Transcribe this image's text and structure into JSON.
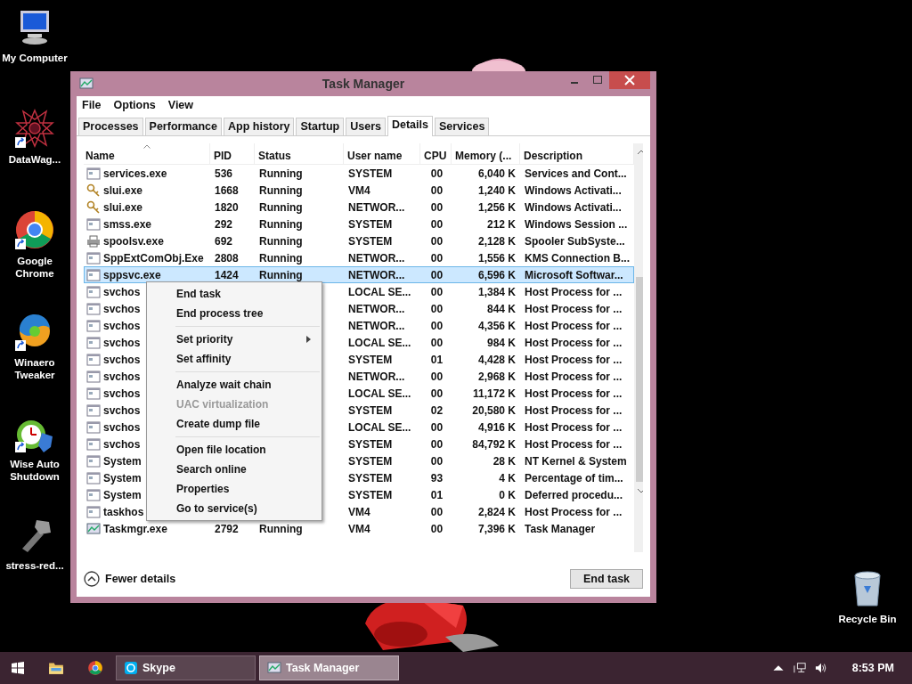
{
  "desktop_icons": [
    {
      "label": "My Computer",
      "kind": "computer",
      "shortcut": false
    },
    {
      "label": "DataWag...",
      "kind": "star",
      "shortcut": true
    },
    {
      "label": "Google Chrome",
      "kind": "chrome",
      "shortcut": true
    },
    {
      "label": "Winaero Tweaker",
      "kind": "swirl",
      "shortcut": true
    },
    {
      "label": "Wise Auto Shutdown",
      "kind": "clock",
      "shortcut": true
    },
    {
      "label": "stress-red...",
      "kind": "tool",
      "shortcut": false
    }
  ],
  "recycle_bin": {
    "label": "Recycle Bin"
  },
  "window": {
    "title": "Task Manager",
    "menu": [
      "File",
      "Options",
      "View"
    ],
    "tabs": [
      {
        "label": "Processes",
        "selected": false
      },
      {
        "label": "Performance",
        "selected": false
      },
      {
        "label": "App history",
        "selected": false
      },
      {
        "label": "Startup",
        "selected": false
      },
      {
        "label": "Users",
        "selected": false
      },
      {
        "label": "Details",
        "selected": true
      },
      {
        "label": "Services",
        "selected": false
      }
    ],
    "columns": [
      {
        "label": "Name",
        "sorted": true
      },
      {
        "label": "PID",
        "sorted": false
      },
      {
        "label": "Status",
        "sorted": false
      },
      {
        "label": "User name",
        "sorted": false
      },
      {
        "label": "CPU",
        "sorted": false
      },
      {
        "label": "Memory (...",
        "sorted": false
      },
      {
        "label": "Description",
        "sorted": false
      }
    ],
    "rows": [
      {
        "kind": "app",
        "name": "services.exe",
        "pid": "536",
        "status": "Running",
        "user": "SYSTEM",
        "cpu": "00",
        "memory": "6,040 K",
        "description": "Services and Cont...",
        "selected": false
      },
      {
        "kind": "key",
        "name": "slui.exe",
        "pid": "1668",
        "status": "Running",
        "user": "VM4",
        "cpu": "00",
        "memory": "1,240 K",
        "description": "Windows Activati...",
        "selected": false
      },
      {
        "kind": "key",
        "name": "slui.exe",
        "pid": "1820",
        "status": "Running",
        "user": "NETWOR...",
        "cpu": "00",
        "memory": "1,256 K",
        "description": "Windows Activati...",
        "selected": false
      },
      {
        "kind": "app",
        "name": "smss.exe",
        "pid": "292",
        "status": "Running",
        "user": "SYSTEM",
        "cpu": "00",
        "memory": "212 K",
        "description": "Windows Session ...",
        "selected": false
      },
      {
        "kind": "printer",
        "name": "spoolsv.exe",
        "pid": "692",
        "status": "Running",
        "user": "SYSTEM",
        "cpu": "00",
        "memory": "2,128 K",
        "description": "Spooler SubSyste...",
        "selected": false
      },
      {
        "kind": "app",
        "name": "SppExtComObj.Exe",
        "pid": "2808",
        "status": "Running",
        "user": "NETWOR...",
        "cpu": "00",
        "memory": "1,556 K",
        "description": "KMS Connection B...",
        "selected": false
      },
      {
        "kind": "app",
        "name": "sppsvc.exe",
        "pid": "1424",
        "status": "Running",
        "user": "NETWOR...",
        "cpu": "00",
        "memory": "6,596 K",
        "description": "Microsoft Softwar...",
        "selected": true
      },
      {
        "kind": "app",
        "name": "svchos",
        "user": "LOCAL SE...",
        "cpu": "00",
        "memory": "1,384 K",
        "description": "Host Process for ...",
        "selected": false
      },
      {
        "kind": "app",
        "name": "svchos",
        "user": "NETWOR...",
        "cpu": "00",
        "memory": "844 K",
        "description": "Host Process for ...",
        "selected": false
      },
      {
        "kind": "app",
        "name": "svchos",
        "user": "NETWOR...",
        "cpu": "00",
        "memory": "4,356 K",
        "description": "Host Process for ...",
        "selected": false
      },
      {
        "kind": "app",
        "name": "svchos",
        "user": "LOCAL SE...",
        "cpu": "00",
        "memory": "984 K",
        "description": "Host Process for ...",
        "selected": false
      },
      {
        "kind": "app",
        "name": "svchos",
        "user": "SYSTEM",
        "cpu": "01",
        "memory": "4,428 K",
        "description": "Host Process for ...",
        "selected": false
      },
      {
        "kind": "app",
        "name": "svchos",
        "user": "NETWOR...",
        "cpu": "00",
        "memory": "2,968 K",
        "description": "Host Process for ...",
        "selected": false
      },
      {
        "kind": "app",
        "name": "svchos",
        "user": "LOCAL SE...",
        "cpu": "00",
        "memory": "11,172 K",
        "description": "Host Process for ...",
        "selected": false
      },
      {
        "kind": "app",
        "name": "svchos",
        "user": "SYSTEM",
        "cpu": "02",
        "memory": "20,580 K",
        "description": "Host Process for ...",
        "selected": false
      },
      {
        "kind": "app",
        "name": "svchos",
        "user": "LOCAL SE...",
        "cpu": "00",
        "memory": "4,916 K",
        "description": "Host Process for ...",
        "selected": false
      },
      {
        "kind": "app",
        "name": "svchos",
        "user": "SYSTEM",
        "cpu": "00",
        "memory": "84,792 K",
        "description": "Host Process for ...",
        "selected": false
      },
      {
        "kind": "app",
        "name": "System",
        "user": "SYSTEM",
        "cpu": "00",
        "memory": "28 K",
        "description": "NT Kernel & System",
        "selected": false
      },
      {
        "kind": "app",
        "name": "System",
        "user": "SYSTEM",
        "cpu": "93",
        "memory": "4 K",
        "description": "Percentage of tim...",
        "selected": false
      },
      {
        "kind": "app",
        "name": "System",
        "user": "SYSTEM",
        "cpu": "01",
        "memory": "0 K",
        "description": "Deferred procedu...",
        "selected": false
      },
      {
        "kind": "app",
        "name": "taskhos",
        "user": "VM4",
        "cpu": "00",
        "memory": "2,824 K",
        "description": "Host Process for ...",
        "selected": false
      },
      {
        "kind": "chart",
        "name": "Taskmgr.exe",
        "pid": "2792",
        "status": "Running",
        "user": "VM4",
        "cpu": "00",
        "memory": "7,396 K",
        "description": "Task Manager",
        "selected": false
      }
    ],
    "context_menu": [
      {
        "kind": "item",
        "label": "End task",
        "disabled": false,
        "submenu": false
      },
      {
        "kind": "item",
        "label": "End process tree",
        "disabled": false,
        "submenu": false
      },
      {
        "kind": "separator"
      },
      {
        "kind": "item",
        "label": "Set priority",
        "disabled": false,
        "submenu": true
      },
      {
        "kind": "item",
        "label": "Set affinity",
        "disabled": false,
        "submenu": false
      },
      {
        "kind": "separator"
      },
      {
        "kind": "item",
        "label": "Analyze wait chain",
        "disabled": false,
        "submenu": false
      },
      {
        "kind": "item",
        "label": "UAC virtualization",
        "disabled": true,
        "submenu": false
      },
      {
        "kind": "item",
        "label": "Create dump file",
        "disabled": false,
        "submenu": false
      },
      {
        "kind": "separator"
      },
      {
        "kind": "item",
        "label": "Open file location",
        "disabled": false,
        "submenu": false
      },
      {
        "kind": "item",
        "label": "Search online",
        "disabled": false,
        "submenu": false
      },
      {
        "kind": "item",
        "label": "Properties",
        "disabled": false,
        "submenu": false
      },
      {
        "kind": "item",
        "label": "Go to service(s)",
        "disabled": false,
        "submenu": false
      }
    ],
    "footer": {
      "toggle": "Fewer details",
      "button": "End task"
    }
  },
  "taskbar": {
    "buttons": [
      {
        "label": "Skype",
        "kind": "skype",
        "selected": false
      },
      {
        "label": "Task Manager",
        "kind": "chart",
        "selected": true
      }
    ],
    "clock": "8:53 PM"
  }
}
